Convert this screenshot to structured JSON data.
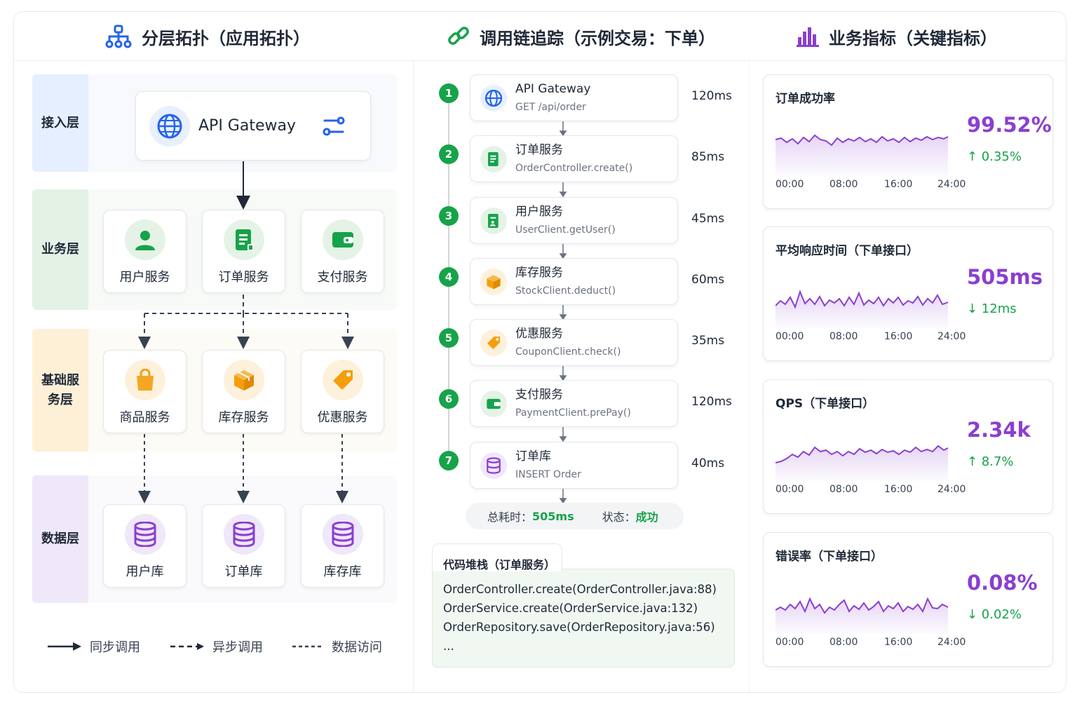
{
  "sections": {
    "topology_title": "分层拓扑（应用拓扑）",
    "trace_title": "调用链追踪（示例交易：下单）",
    "metrics_title": "业务指标（关键指标）"
  },
  "topology": {
    "layers": [
      "接入层",
      "业务层",
      "基础服务层",
      "数据层"
    ],
    "gateway": "API Gateway",
    "business": [
      "用户服务",
      "订单服务",
      "支付服务"
    ],
    "foundation": [
      "商品服务",
      "库存服务",
      "优惠服务"
    ],
    "data": [
      "用户库",
      "订单库",
      "库存库"
    ],
    "legend": [
      "同步调用",
      "异步调用",
      "数据访问"
    ]
  },
  "trace": {
    "steps": [
      {
        "num": "1",
        "name": "API Gateway",
        "detail": "GET /api/order",
        "duration": "120ms",
        "icon": "globe-icon"
      },
      {
        "num": "2",
        "name": "订单服务",
        "detail": "OrderController.create()",
        "duration": "85ms",
        "icon": "document-icon"
      },
      {
        "num": "3",
        "name": "用户服务",
        "detail": "UserClient.getUser()",
        "duration": "45ms",
        "icon": "user-doc-icon"
      },
      {
        "num": "4",
        "name": "库存服务",
        "detail": "StockClient.deduct()",
        "duration": "60ms",
        "icon": "box-icon"
      },
      {
        "num": "5",
        "name": "优惠服务",
        "detail": "CouponClient.check()",
        "duration": "35ms",
        "icon": "tag-icon"
      },
      {
        "num": "6",
        "name": "支付服务",
        "detail": "PaymentClient.prePay()",
        "duration": "120ms",
        "icon": "wallet-icon"
      },
      {
        "num": "7",
        "name": "订单库",
        "detail": "INSERT Order",
        "duration": "40ms",
        "icon": "database-icon"
      }
    ],
    "summary": {
      "total_label": "总耗时：",
      "total_value": "505ms",
      "status_label": "状态：",
      "status_value": "成功"
    },
    "code": {
      "title": "代码堆栈（订单服务）",
      "lines": [
        "OrderController.create(OrderController.java:88)",
        "OrderService.create(OrderService.java:132)",
        "OrderRepository.save(OrderRepository.java:56)",
        "..."
      ]
    }
  },
  "metrics": {
    "x_ticks": [
      "00:00",
      "08:00",
      "16:00",
      "24:00"
    ],
    "cards": [
      {
        "title": "订单成功率",
        "value": "99.52%",
        "delta": "↑ 0.35%"
      },
      {
        "title": "平均响应时间（下单接口）",
        "value": "505ms",
        "delta": "↓ 12ms"
      },
      {
        "title": "QPS（下单接口）",
        "value": "2.34k",
        "delta": "↑ 8.7%"
      },
      {
        "title": "错误率（下单接口）",
        "value": "0.08%",
        "delta": "↓ 0.02%"
      }
    ]
  },
  "colors": {
    "accent_purple": "#8b3fd1",
    "success_green": "#16a34a",
    "gateway_blue": "#2563eb",
    "orange": "#f59e0b"
  }
}
